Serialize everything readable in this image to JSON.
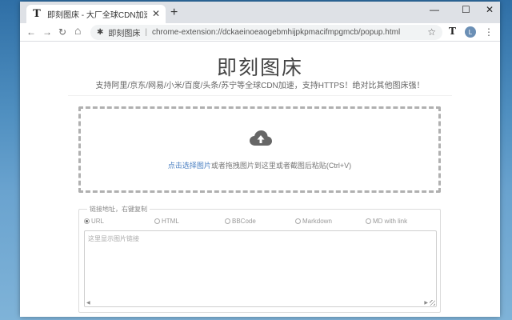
{
  "browser": {
    "tab_title": "即刻图床 - 大厂全球CDN加速,支",
    "tab_favicon": "T",
    "close_glyph": "✕",
    "new_tab_glyph": "+",
    "minimize_glyph": "—",
    "maximize_glyph": "☐",
    "window_close_glyph": "✕",
    "back_glyph": "←",
    "forward_glyph": "→",
    "reload_glyph": "↻",
    "home_glyph": "⌂",
    "extension_name": "即刻图床",
    "separator": "|",
    "url": "chrome-extension://dckaeinoeaogebmhijpkpmacifmpgmcb/popup.html",
    "star_glyph": "☆",
    "extension_icon_letter": "T",
    "avatar_letter": "L",
    "menu_glyph": "⋮"
  },
  "app": {
    "title": "即刻图床",
    "subtitle": "支持阿里/京东/网易/小米/百度/头条/苏宁等全球CDN加速，支持HTTPS！绝对比其他图床强！"
  },
  "upload": {
    "link_text": "点击选择图片",
    "hint_text": "或者拖拽图片到这里或者截图后粘贴(Ctrl+V)",
    "icon": "cloud-upload-icon"
  },
  "links": {
    "legend": "链接地址，右键复制",
    "formats": [
      {
        "label": "URL",
        "checked": true
      },
      {
        "label": "HTML",
        "checked": false
      },
      {
        "label": "BBCode",
        "checked": false
      },
      {
        "label": "Markdown",
        "checked": false
      },
      {
        "label": "MD with link",
        "checked": false
      }
    ],
    "textarea_placeholder": "这里显示图片链接"
  },
  "colors": {
    "link": "#4a7fc1",
    "dashed_border": "#b0b0b0",
    "title": "#444444"
  }
}
